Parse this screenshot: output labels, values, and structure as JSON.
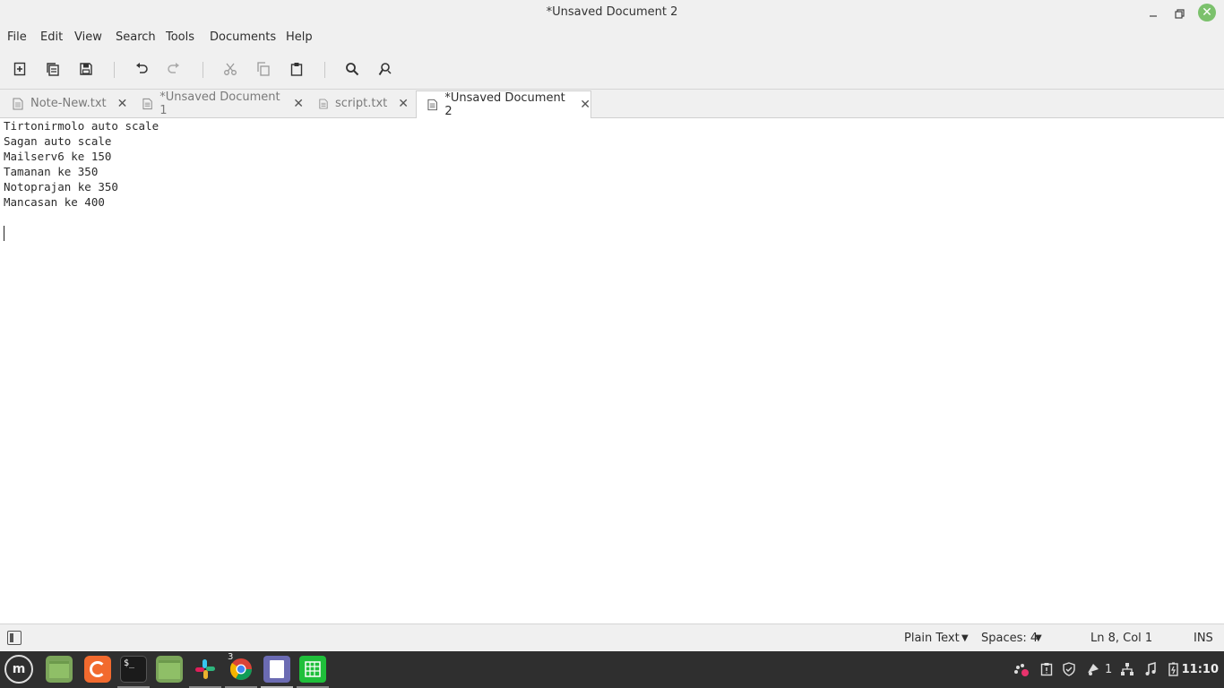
{
  "window": {
    "title": "*Unsaved Document 2"
  },
  "menu": [
    "File",
    "Edit",
    "View",
    "Search",
    "Tools",
    "Documents",
    "Help"
  ],
  "tabs": [
    {
      "label": "Note-New.txt",
      "active": false
    },
    {
      "label": "*Unsaved Document 1",
      "active": false
    },
    {
      "label": "script.txt",
      "active": false
    },
    {
      "label": "*Unsaved Document 2",
      "active": true
    }
  ],
  "editor": {
    "lines": [
      "Tirtonirmolo auto scale",
      "Sagan auto scale",
      "Mailserv6 ke 150",
      "Tamanan ke 350",
      "Notoprajan ke 350",
      "Mancasan ke 400",
      "",
      ""
    ]
  },
  "status": {
    "language": "Plain Text",
    "spaces": "Spaces: 4",
    "position": "Ln 8, Col 1",
    "mode": "INS"
  },
  "taskbar": {
    "chrome_badge": "3",
    "workspace": "1",
    "clock": "11:10"
  }
}
